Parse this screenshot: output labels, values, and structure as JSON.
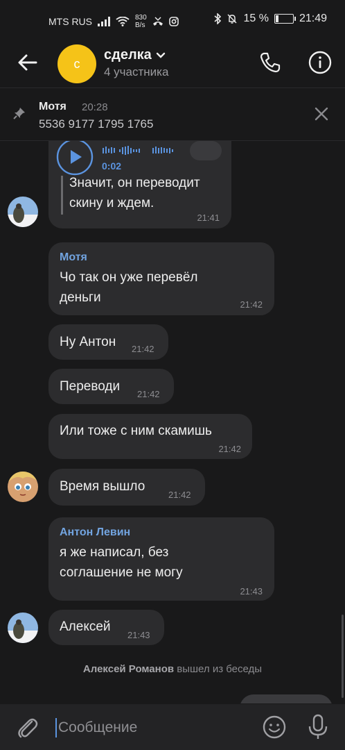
{
  "status_bar": {
    "carrier": "MTS RUS",
    "speed_value": "830",
    "speed_unit": "B/s",
    "battery_percent": "15 %",
    "battery_level": 0.15,
    "time": "21:49"
  },
  "header": {
    "avatar_letter": "с",
    "avatar_color": "#f5c318",
    "title": "сделка",
    "subtitle": "4 участника"
  },
  "pinned": {
    "author": "Мотя",
    "time": "20:28",
    "text": "5536 9177 1795 1765"
  },
  "messages": {
    "m0": {
      "voice_duration": "0:02",
      "quote": "Значит, он переводит\nскину и ждем.",
      "time": "21:41"
    },
    "m1": {
      "author": "Мотя",
      "text": "Чо так он уже перевёл\nденьги",
      "time": "21:42"
    },
    "m2": {
      "text": "Ну Антон",
      "time": "21:42"
    },
    "m3": {
      "text": "Переводи",
      "time": "21:42"
    },
    "m4": {
      "text": "Или тоже с ним скамишь",
      "time": "21:42"
    },
    "m5": {
      "text": "Время вышло",
      "time": "21:42"
    },
    "m6": {
      "author": "Антон Левин",
      "text": "я же написал, без\nсоглашение не могу",
      "time": "21:43"
    },
    "m7": {
      "text": "Алексей",
      "time": "21:43"
    }
  },
  "system_message": {
    "name": "Алексей Романов",
    "action": "вышел из беседы"
  },
  "composer": {
    "placeholder": "Сообщение"
  },
  "colors": {
    "background": "#19191a",
    "bubble": "#2c2c2e",
    "accent": "#72a4e0"
  }
}
